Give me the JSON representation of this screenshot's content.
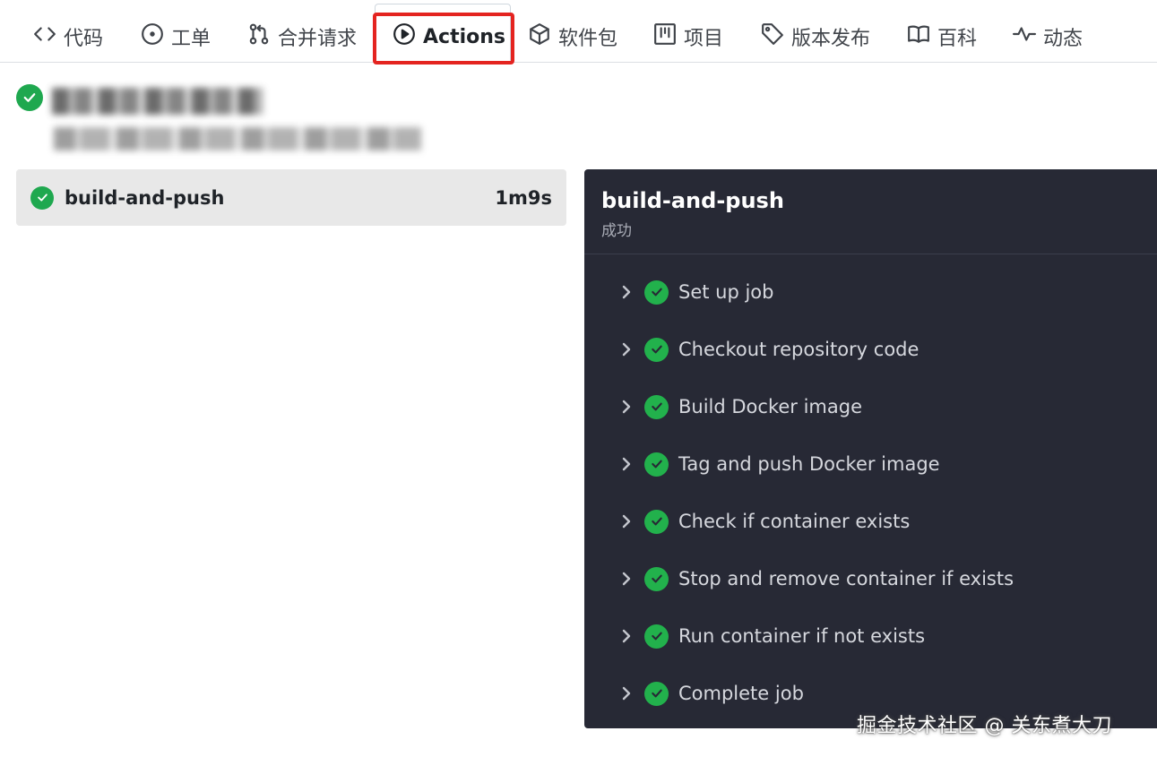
{
  "nav": {
    "tabs": [
      {
        "label": "代码",
        "icon": "code-icon"
      },
      {
        "label": "工单",
        "icon": "issue-icon"
      },
      {
        "label": "合并请求",
        "icon": "pull-request-icon"
      },
      {
        "label": "Actions",
        "icon": "play-icon",
        "active": true
      },
      {
        "label": "软件包",
        "icon": "package-icon"
      },
      {
        "label": "项目",
        "icon": "project-icon"
      },
      {
        "label": "版本发布",
        "icon": "tag-icon"
      },
      {
        "label": "百科",
        "icon": "book-icon"
      },
      {
        "label": "动态",
        "icon": "pulse-icon"
      }
    ]
  },
  "job_list": {
    "items": [
      {
        "name": "build-and-push",
        "duration": "1m9s",
        "status": "success"
      }
    ]
  },
  "job_detail": {
    "title": "build-and-push",
    "status": "成功",
    "steps": [
      {
        "label": "Set up job"
      },
      {
        "label": "Checkout repository code"
      },
      {
        "label": "Build Docker image"
      },
      {
        "label": "Tag and push Docker image"
      },
      {
        "label": "Check if container exists"
      },
      {
        "label": "Stop and remove container if exists"
      },
      {
        "label": "Run container if not exists"
      },
      {
        "label": "Complete job"
      }
    ]
  },
  "watermark": "掘金技术社区 @ 关东煮大刀",
  "colors": {
    "success": "#22b14c",
    "highlight": "#e42420",
    "panel_bg": "#272935"
  }
}
